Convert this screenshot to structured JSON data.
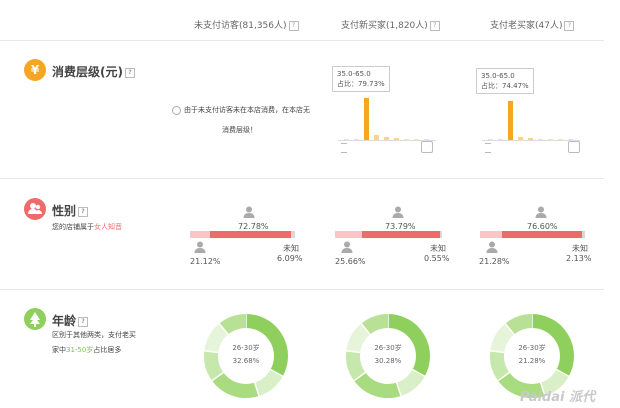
{
  "header": {
    "col1": "未支付访客(81,356人)",
    "col2": "支付新买家(1,820人)",
    "col3": "支付老买家(47人)",
    "help": "?"
  },
  "consumption": {
    "title": "消费层级(元)",
    "icon": "¥",
    "help": "?",
    "notice_line1": "由于未支付访客未在本店消费，在本店无",
    "notice_line2": "消费层级！",
    "new_tooltip_range": "35.0-65.0",
    "new_tooltip_share": "占比：79.73%",
    "old_tooltip_range": "35.0-65.0",
    "old_tooltip_share": "占比：74.47%",
    "new_bars": [
      0.01,
      0.01,
      0.7973,
      0.09,
      0.06,
      0.03,
      0.01,
      0.01,
      0.01
    ],
    "old_bars": [
      0.01,
      0.01,
      0.7447,
      0.06,
      0.04,
      0.02,
      0.01,
      0.01,
      0.01
    ]
  },
  "gender": {
    "title": "性别",
    "help": "?",
    "desc_prefix": "您的店铺属于",
    "desc_highlight": "女人知音",
    "unknown_label": "未知",
    "col1": {
      "female": "72.78%",
      "male": "21.12%",
      "unknown": "6.09%"
    },
    "col2": {
      "female": "73.79%",
      "male": "25.66%",
      "unknown": "0.55%"
    },
    "col3": {
      "female": "76.60%",
      "male": "21.28%",
      "unknown": "2.13%"
    }
  },
  "age": {
    "title": "年龄",
    "help": "?",
    "desc_line1": "区别于其他两类，支付老买",
    "desc_line2_prefix": "家中",
    "desc_line2_highlight": "31-50岁",
    "desc_line2_suffix": "占比居多",
    "col1": {
      "range": "26-30岁",
      "share": "32.68%"
    },
    "col2": {
      "range": "26-30岁",
      "share": "30.28%"
    },
    "col3": {
      "range": "26-30岁",
      "share": "21.28%"
    }
  },
  "watermark": "Paidai 派代",
  "colors": {
    "orange": "#f5a623",
    "red": "#ef6a6a",
    "green": "#8fcf5e",
    "pink": "#f7c6c6"
  }
}
